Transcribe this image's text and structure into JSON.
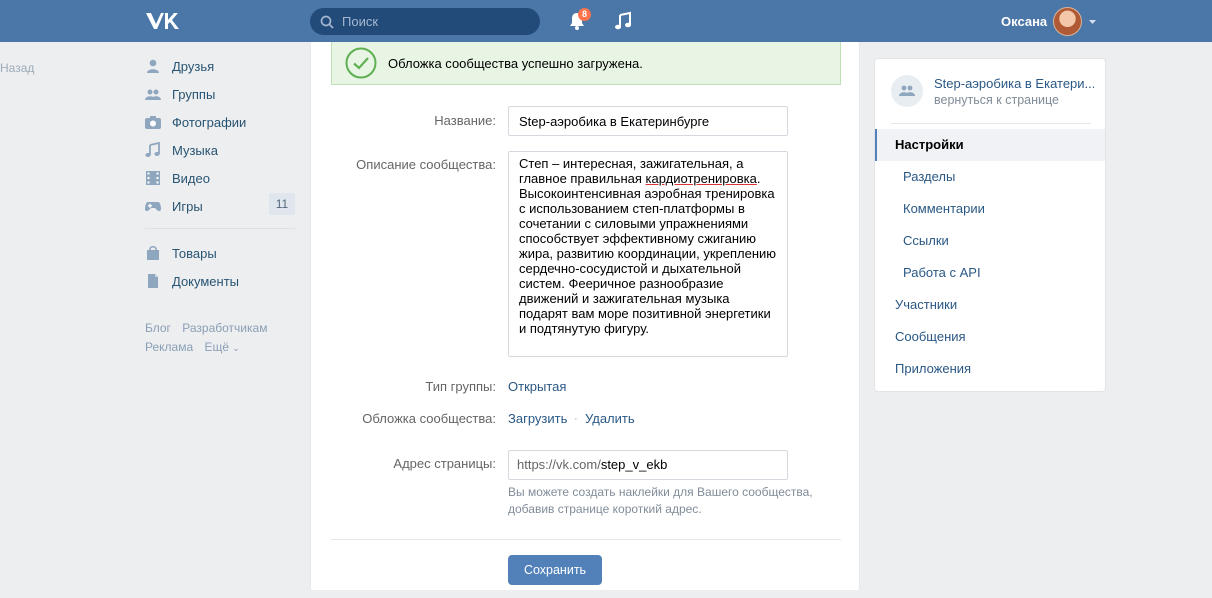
{
  "header": {
    "search_placeholder": "Поиск",
    "notifications_count": "8",
    "user_name": "Оксана"
  },
  "left_menu": {
    "back_label": "Назад",
    "items": [
      {
        "label": "Друзья",
        "icon": "friends-icon"
      },
      {
        "label": "Группы",
        "icon": "groups-icon"
      },
      {
        "label": "Фотографии",
        "icon": "camera-icon"
      },
      {
        "label": "Музыка",
        "icon": "music-note-icon"
      },
      {
        "label": "Видео",
        "icon": "film-icon"
      },
      {
        "label": "Игры",
        "icon": "gamepad-icon",
        "count": "11"
      },
      {
        "label": "Товары",
        "icon": "shopping-bag-icon"
      },
      {
        "label": "Документы",
        "icon": "document-icon"
      }
    ],
    "footer_links": [
      "Блог",
      "Разработчикам",
      "Реклама",
      "Ещё"
    ]
  },
  "main": {
    "success_message": "Обложка сообщества успешно загружена.",
    "name_label": "Название:",
    "name_value": "Step-аэробика в Екатеринбурге",
    "description_label": "Описание сообщества:",
    "description_before": "Степ – интересная, зажигательная, а главное правильная ",
    "description_underlined": "кардиотренировка",
    "description_after": ". Высокоинтенсивная аэробная тренировка с использованием степ-платформы в сочетании с силовыми упражнениями способствует эффективному сжиганию жира, развитию координации, укреплению сердечно-сосудистой и дыхательной систем. Фееричное разнообразие движений и зажигательная музыка подарят вам море позитивной энергетики и подтянутую фигуру.",
    "group_type_label": "Тип группы:",
    "group_type_value": "Открытая",
    "cover_label": "Обложка сообщества:",
    "cover_upload": "Загрузить",
    "cover_delete": "Удалить",
    "address_label": "Адрес страницы:",
    "address_prefix": "https://vk.com/",
    "address_value": "step_v_ekb",
    "address_hint": "Вы можете создать наклейки для Вашего сообщества, добавив странице короткий адрес.",
    "save_button": "Сохранить"
  },
  "right_panel": {
    "group_title": "Step-аэробика в Екатери...",
    "back_link": "вернуться к странице",
    "items": [
      {
        "label": "Настройки",
        "active": true
      },
      {
        "label": "Разделы",
        "sub": true
      },
      {
        "label": "Комментарии",
        "sub": true
      },
      {
        "label": "Ссылки",
        "sub": true
      },
      {
        "label": "Работа с API",
        "sub": true
      },
      {
        "label": "Участники"
      },
      {
        "label": "Сообщения"
      },
      {
        "label": "Приложения"
      }
    ]
  },
  "colors": {
    "header_bg": "#4a76a8",
    "link": "#2a5885",
    "button": "#5181b8",
    "success_bg": "#e8f5e4"
  }
}
